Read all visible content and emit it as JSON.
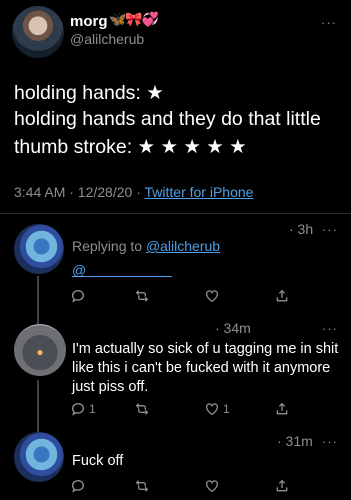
{
  "main_tweet": {
    "display_name": "morg",
    "name_emoji": "🦋🎀💞",
    "handle": "@alilcherub",
    "line1": "holding hands: ★",
    "line2": "holding hands and they do that little",
    "line3": "thumb stroke: ★ ★ ★ ★ ★",
    "time": "3:44 AM · 12/28/20 · ",
    "source": "Twitter for iPhone",
    "more": "···"
  },
  "replies": [
    {
      "time": "· 3h",
      "more": "···",
      "replying_prefix": "Replying to ",
      "replying_handle": "@alilcherub",
      "mention": "@",
      "counts": {
        "reply": "",
        "retweet": "",
        "like": ""
      }
    },
    {
      "time": "· 34m",
      "more": "···",
      "text": "I'm actually so sick of u tagging me in shit like this i can't be fucked with it anymore just piss off.",
      "counts": {
        "reply": "1",
        "retweet": "",
        "like": "1"
      }
    },
    {
      "time": "· 31m",
      "more": "···",
      "text": "Fuck off",
      "counts": {
        "reply": "",
        "retweet": "",
        "like": ""
      }
    }
  ],
  "icons": [
    "reply-icon",
    "retweet-icon",
    "like-icon",
    "share-icon",
    "more-icon"
  ],
  "colors": {
    "background": "#000000",
    "link": "#4da0e8",
    "muted": "#8b8f94",
    "separator": "#2a2d31"
  }
}
